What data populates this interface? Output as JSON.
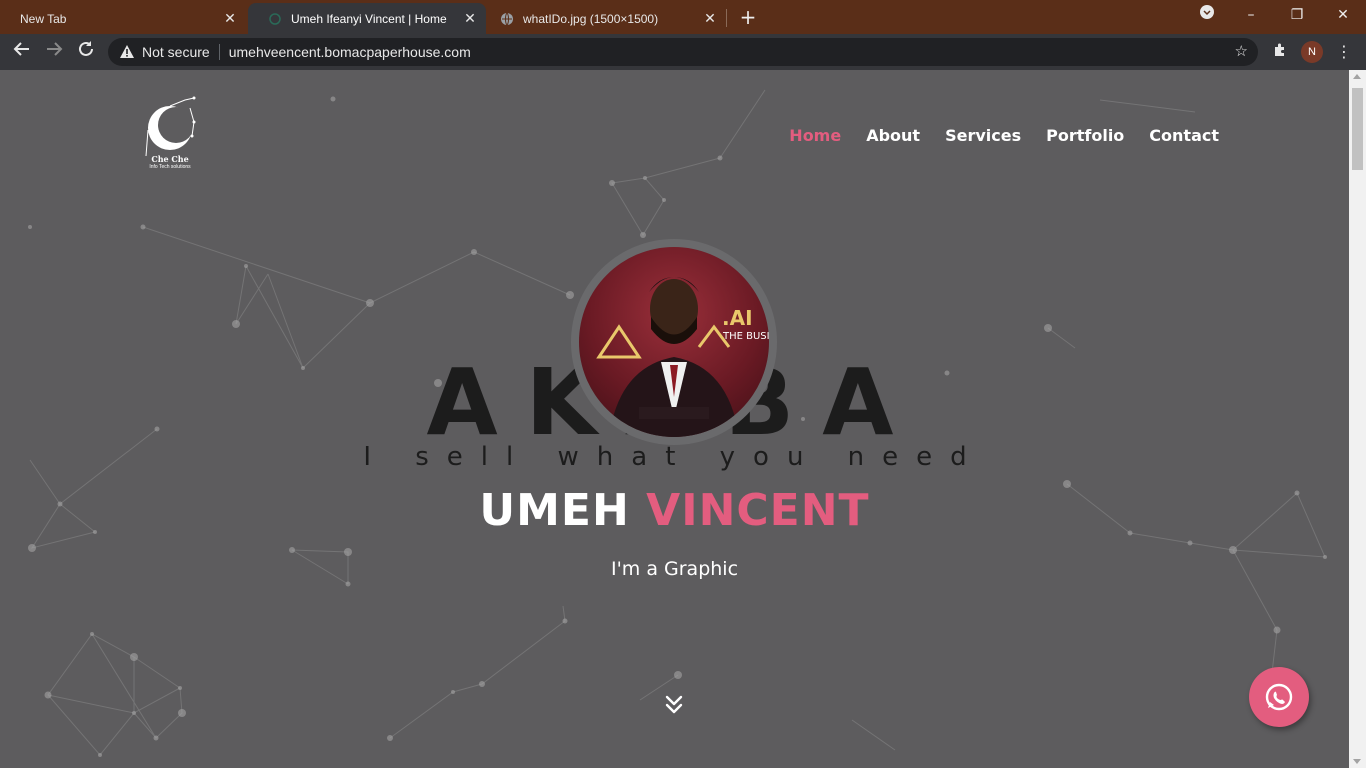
{
  "browser": {
    "tabs": [
      {
        "title": "New Tab",
        "active": false
      },
      {
        "title": "Umeh Ifeanyi Vincent | Home",
        "active": true
      },
      {
        "title": "whatIDo.jpg (1500×1500)",
        "active": false
      }
    ],
    "security_label": "Not secure",
    "url": "umehveencent.bomacpaperhouse.com",
    "profile_initial": "N",
    "window_controls": {
      "minimize": "–",
      "restore": "❐",
      "close": "✕"
    }
  },
  "site": {
    "logo": {
      "line1": "Che Che",
      "line2": "Info Tech solutions"
    },
    "nav": [
      {
        "label": "Home",
        "active": true
      },
      {
        "label": "About",
        "active": false
      },
      {
        "label": "Services",
        "active": false
      },
      {
        "label": "Portfolio",
        "active": false
      },
      {
        "label": "Contact",
        "active": false
      }
    ],
    "brand_big": "AKABA",
    "brand_tag": "I sell what you need",
    "hero": {
      "first_name": "UMEH",
      "last_name": "VINCENT",
      "subtitle": "I'm a Graphic"
    },
    "avatar_badge": {
      "line1": ".AI",
      "line2": "THE BUSI"
    },
    "colors": {
      "accent": "#e35d7f",
      "background": "#5d5c5e",
      "tabstrip": "#5a2e18"
    },
    "icons": {
      "scroll": "chevrons-down-icon",
      "chat": "whatsapp-icon"
    }
  }
}
